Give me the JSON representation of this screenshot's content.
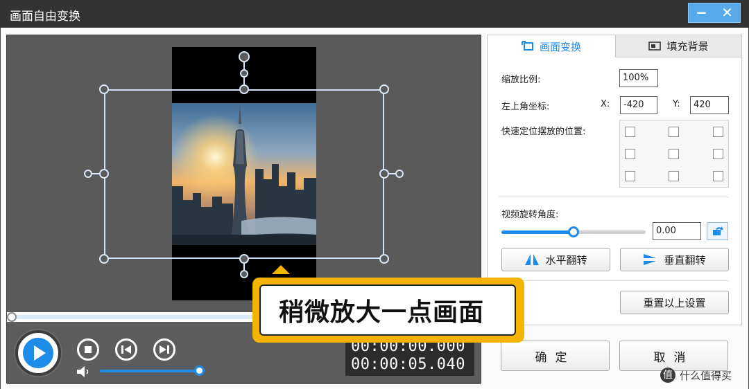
{
  "window": {
    "title": "画面自由变换",
    "minimize": "−",
    "close": "✕"
  },
  "player": {
    "time_current": "00:00:00.000",
    "time_total": "00:00:05.040",
    "dropdown_glyph": "⌄",
    "volume": 1.0,
    "progress": 0.0
  },
  "tabs": [
    {
      "label": "画面变换",
      "icon": "transform-icon",
      "active": true
    },
    {
      "label": "填充背景",
      "icon": "fill-background-icon",
      "active": false
    }
  ],
  "transform": {
    "scale_label": "缩放比例:",
    "scale_value": "100%",
    "position_label": "左上角坐标:",
    "x_label": "X:",
    "x_value": "-420",
    "y_label": "Y:",
    "y_value": "420",
    "quick_position_label": "快速定位摆放的位置:",
    "rotation_label": "视频旋转角度:",
    "rotation_value": "0.00",
    "rotation_slider_fraction": 0.5,
    "flip_horizontal": "水平翻转",
    "flip_vertical": "垂直翻转",
    "reset": "重置以上设置"
  },
  "footer": {
    "ok": "确定",
    "cancel": "取消"
  },
  "annotation": {
    "text": "稍微放大一点画面"
  },
  "watermark": {
    "badge": "值",
    "text": "什么值得买"
  },
  "colors": {
    "accent": "#1d8be8",
    "highlight": "#f5b400",
    "titlebar": "#333333"
  }
}
